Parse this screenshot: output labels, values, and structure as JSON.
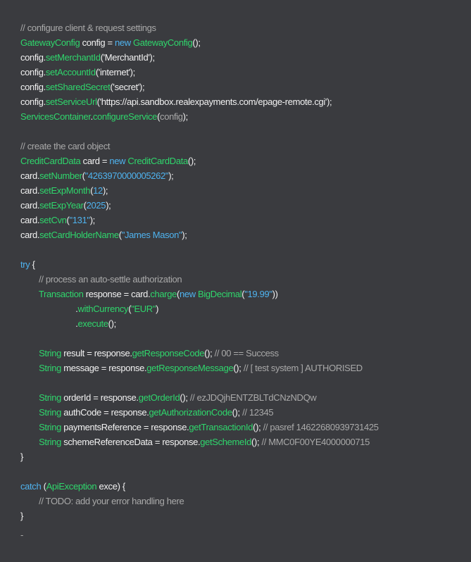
{
  "code_lines": [
    [
      {
        "t": "// configure client & request settings",
        "k": "comment"
      }
    ],
    [
      {
        "t": "GatewayConfig",
        "k": "type"
      },
      {
        "t": " config = ",
        "k": "plain"
      },
      {
        "t": "new",
        "k": "keyword"
      },
      {
        "t": " ",
        "k": "plain"
      },
      {
        "t": "GatewayConfig",
        "k": "type"
      },
      {
        "t": "();",
        "k": "plain"
      }
    ],
    [
      {
        "t": "config.",
        "k": "plain"
      },
      {
        "t": "setMerchantId",
        "k": "method"
      },
      {
        "t": "('MerchantId');",
        "k": "plain"
      }
    ],
    [
      {
        "t": "config.",
        "k": "plain"
      },
      {
        "t": "setAccountId",
        "k": "method"
      },
      {
        "t": "('internet');",
        "k": "plain"
      }
    ],
    [
      {
        "t": "config.",
        "k": "plain"
      },
      {
        "t": "setSharedSecret",
        "k": "method"
      },
      {
        "t": "('secret');",
        "k": "plain"
      }
    ],
    [
      {
        "t": "config.",
        "k": "plain"
      },
      {
        "t": "setServiceUrl",
        "k": "method"
      },
      {
        "t": "('https://api.sandbox.realexpayments.com/epage-remote.cgi');",
        "k": "plain"
      }
    ],
    [
      {
        "t": "ServicesContainer",
        "k": "type"
      },
      {
        "t": ".",
        "k": "plain"
      },
      {
        "t": "configureService",
        "k": "method"
      },
      {
        "t": "(",
        "k": "plain"
      },
      {
        "t": "config",
        "k": "muted"
      },
      {
        "t": ");",
        "k": "plain"
      }
    ],
    [],
    [
      {
        "t": "// create the card object",
        "k": "comment"
      }
    ],
    [
      {
        "t": "CreditCardData",
        "k": "type"
      },
      {
        "t": " card = ",
        "k": "plain"
      },
      {
        "t": "new",
        "k": "keyword"
      },
      {
        "t": " ",
        "k": "plain"
      },
      {
        "t": "CreditCardData",
        "k": "type"
      },
      {
        "t": "();",
        "k": "plain"
      }
    ],
    [
      {
        "t": "card.",
        "k": "plain"
      },
      {
        "t": "setNumber",
        "k": "method"
      },
      {
        "t": "(",
        "k": "plain"
      },
      {
        "t": "\"4263970000005262\"",
        "k": "string"
      },
      {
        "t": ");",
        "k": "plain"
      }
    ],
    [
      {
        "t": "card.",
        "k": "plain"
      },
      {
        "t": "setExpMonth",
        "k": "method"
      },
      {
        "t": "(",
        "k": "plain"
      },
      {
        "t": "12",
        "k": "number"
      },
      {
        "t": ");",
        "k": "plain"
      }
    ],
    [
      {
        "t": "card.",
        "k": "plain"
      },
      {
        "t": "setExpYear",
        "k": "method"
      },
      {
        "t": "(",
        "k": "plain"
      },
      {
        "t": "2025",
        "k": "number"
      },
      {
        "t": ");",
        "k": "plain"
      }
    ],
    [
      {
        "t": "card.",
        "k": "plain"
      },
      {
        "t": "setCvn",
        "k": "method"
      },
      {
        "t": "(",
        "k": "plain"
      },
      {
        "t": "\"131\"",
        "k": "string"
      },
      {
        "t": ");",
        "k": "plain"
      }
    ],
    [
      {
        "t": "card.",
        "k": "plain"
      },
      {
        "t": "setCardHolderName",
        "k": "method"
      },
      {
        "t": "(",
        "k": "plain"
      },
      {
        "t": "\"James Mason\"",
        "k": "string"
      },
      {
        "t": ");",
        "k": "plain"
      }
    ],
    [],
    [
      {
        "t": "try",
        "k": "keyword"
      },
      {
        "t": " {",
        "k": "plain"
      }
    ],
    [
      {
        "t": "        ",
        "k": "plain"
      },
      {
        "t": "// process an auto-settle authorization",
        "k": "comment"
      }
    ],
    [
      {
        "t": "        ",
        "k": "plain"
      },
      {
        "t": "Transaction",
        "k": "type"
      },
      {
        "t": " response = card.",
        "k": "plain"
      },
      {
        "t": "charge",
        "k": "method"
      },
      {
        "t": "(",
        "k": "plain"
      },
      {
        "t": "new",
        "k": "keyword"
      },
      {
        "t": " ",
        "k": "plain"
      },
      {
        "t": "BigDecimal",
        "k": "type"
      },
      {
        "t": "(",
        "k": "plain"
      },
      {
        "t": "\"19.99\"",
        "k": "string"
      },
      {
        "t": "))",
        "k": "plain"
      }
    ],
    [
      {
        "t": "                        .",
        "k": "plain"
      },
      {
        "t": "withCurrency",
        "k": "method"
      },
      {
        "t": "(",
        "k": "plain"
      },
      {
        "t": "\"EUR\"",
        "k": "method"
      },
      {
        "t": ")",
        "k": "plain"
      }
    ],
    [
      {
        "t": "                        .",
        "k": "plain"
      },
      {
        "t": "execute",
        "k": "method"
      },
      {
        "t": "();",
        "k": "plain"
      }
    ],
    [],
    [
      {
        "t": "        ",
        "k": "plain"
      },
      {
        "t": "String",
        "k": "type"
      },
      {
        "t": " result = response.",
        "k": "plain"
      },
      {
        "t": "getResponseCode",
        "k": "method"
      },
      {
        "t": "(); ",
        "k": "plain"
      },
      {
        "t": "// 00 == Success",
        "k": "comment"
      }
    ],
    [
      {
        "t": "        ",
        "k": "plain"
      },
      {
        "t": "String",
        "k": "type"
      },
      {
        "t": " message = response.",
        "k": "plain"
      },
      {
        "t": "getResponseMessage",
        "k": "method"
      },
      {
        "t": "(); ",
        "k": "plain"
      },
      {
        "t": "// [ test system ] AUTHORISED",
        "k": "comment"
      }
    ],
    [],
    [
      {
        "t": "        ",
        "k": "plain"
      },
      {
        "t": "String",
        "k": "type"
      },
      {
        "t": " orderId = response.",
        "k": "plain"
      },
      {
        "t": "getOrderId",
        "k": "method"
      },
      {
        "t": "(); ",
        "k": "plain"
      },
      {
        "t": "// ezJDQjhENTZBLTdCNzNDQw",
        "k": "comment"
      }
    ],
    [
      {
        "t": "        ",
        "k": "plain"
      },
      {
        "t": "String",
        "k": "type"
      },
      {
        "t": " authCode = response.",
        "k": "plain"
      },
      {
        "t": "getAuthorizationCode",
        "k": "method"
      },
      {
        "t": "(); ",
        "k": "plain"
      },
      {
        "t": "// 12345",
        "k": "comment"
      }
    ],
    [
      {
        "t": "        ",
        "k": "plain"
      },
      {
        "t": "String",
        "k": "type"
      },
      {
        "t": " paymentsReference = response.",
        "k": "plain"
      },
      {
        "t": "getTransactionId",
        "k": "method"
      },
      {
        "t": "(); ",
        "k": "plain"
      },
      {
        "t": "// pasref 14622680939731425",
        "k": "comment"
      }
    ],
    [
      {
        "t": "        ",
        "k": "plain"
      },
      {
        "t": "String",
        "k": "type"
      },
      {
        "t": " schemeReferenceData = response.",
        "k": "plain"
      },
      {
        "t": "getSchemeId",
        "k": "method"
      },
      {
        "t": "(); ",
        "k": "plain"
      },
      {
        "t": "// MMC0F00YE4000000715",
        "k": "comment"
      }
    ],
    [
      {
        "t": "}",
        "k": "plain"
      }
    ],
    [],
    [
      {
        "t": "catch",
        "k": "keyword"
      },
      {
        "t": " (",
        "k": "plain"
      },
      {
        "t": "ApiException",
        "k": "type"
      },
      {
        "t": " exce) {",
        "k": "plain"
      }
    ],
    [
      {
        "t": "        ",
        "k": "plain"
      },
      {
        "t": "// TODO: add your error handling here",
        "k": "comment"
      }
    ],
    [
      {
        "t": "}",
        "k": "plain"
      }
    ]
  ],
  "trailing_mark": "-",
  "colors": {
    "background": "#3a3b3f",
    "plain": "#f2f2f2",
    "comment": "#a9a9a9",
    "type": "#2fd66c",
    "keyword": "#4fb3ef",
    "string": "#4fb3ef"
  }
}
